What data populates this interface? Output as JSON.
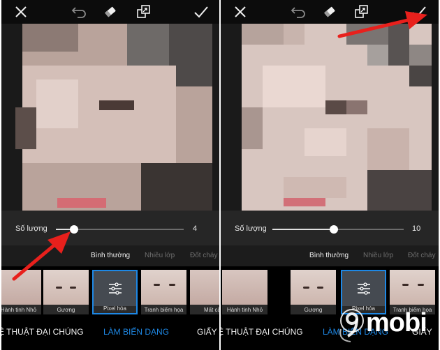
{
  "colors": {
    "accent": "#1e88e5",
    "arrow": "#e8201c",
    "background": "#101010"
  },
  "panels": [
    {
      "toolbar": {
        "close_icon": "close-icon",
        "undo_icon": "undo-icon",
        "eraser_icon": "eraser-icon",
        "layers_icon": "layers-icon",
        "apply_icon": "check-icon"
      },
      "slider": {
        "label": "Số lượng",
        "value": "4",
        "fraction": 0.2
      },
      "blend_modes": [
        "Bình thường",
        "Nhiều lớp",
        "Đốt cháy"
      ],
      "thumbnails": [
        "Hành tinh Nhỏ",
        "Gương",
        "Pixel hóa",
        "Tranh biếm họa",
        "Mất cân"
      ],
      "categories": [
        "Ệ THUẬT ĐẠI CHÚNG",
        "LÀM BIẾN DẠNG",
        "GIẤY"
      ]
    },
    {
      "toolbar": {
        "close_icon": "close-icon",
        "undo_icon": "undo-icon",
        "eraser_icon": "eraser-icon",
        "layers_icon": "layers-icon",
        "apply_icon": "check-icon"
      },
      "slider": {
        "label": "Số lượng",
        "value": "10",
        "fraction": 0.5
      },
      "blend_modes": [
        "Bình thường",
        "Nhiều lớp",
        "Đốt cháy"
      ],
      "thumbnails": [
        "Hành tinh Nhỏ",
        "Gương",
        "Pixel hóa",
        "Tranh biếm họa"
      ],
      "categories": [
        "Ệ THUẬT ĐẠI CHÚNG",
        "LÀM BIẾN DẠNG",
        "GIẤY"
      ]
    }
  ],
  "watermark": {
    "text": "mobi",
    "logo_icon": "9mobi-logo"
  }
}
